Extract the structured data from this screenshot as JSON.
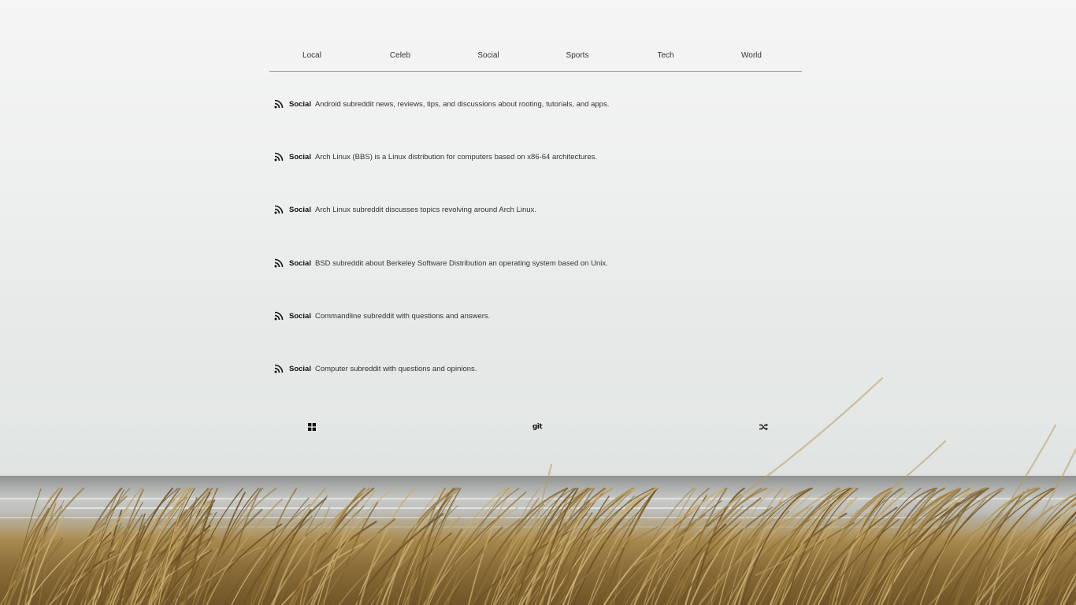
{
  "nav": {
    "tabs": [
      {
        "label": "Local"
      },
      {
        "label": "Celeb"
      },
      {
        "label": "Social"
      },
      {
        "label": "Sports"
      },
      {
        "label": "Tech"
      },
      {
        "label": "World"
      }
    ]
  },
  "feed": {
    "items": [
      {
        "icon": "rss-icon",
        "category": "Social",
        "description": "Android subreddit news, reviews, tips, and discussions about rooting, tutorials, and apps."
      },
      {
        "icon": "rss-icon",
        "category": "Social",
        "description": "Arch Linux (BBS) is a Linux distribution for computers based on x86-64 architectures."
      },
      {
        "icon": "rss-icon",
        "category": "Social",
        "description": "Arch Linux subreddit discusses topics revolving around Arch Linux."
      },
      {
        "icon": "rss-icon",
        "category": "Social",
        "description": "BSD subreddit about Berkeley Software Distribution an operating system based on Unix."
      },
      {
        "icon": "rss-icon",
        "category": "Social",
        "description": "Commandline subreddit with questions and answers."
      },
      {
        "icon": "rss-icon",
        "category": "Social",
        "description": "Computer subreddit with questions and opinions."
      }
    ]
  },
  "footer": {
    "icons": [
      "grid-icon",
      "git-icon",
      "shuffle-icon"
    ],
    "git_label": "git"
  },
  "colors": {
    "text": "#222222",
    "nav_border": "#9a9d9c"
  }
}
